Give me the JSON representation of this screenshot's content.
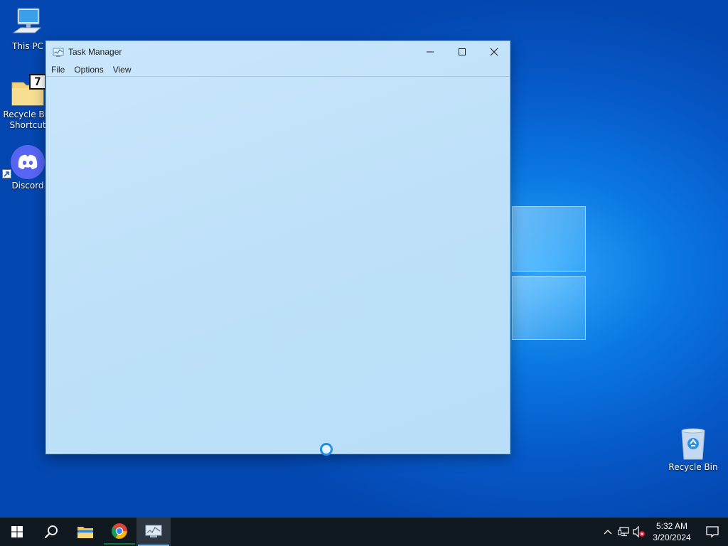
{
  "desktop": {
    "icons": [
      {
        "label_line1": "This PC",
        "label_line2": "",
        "icon": "computer-icon"
      },
      {
        "label_line1": "Recycle Bin",
        "label_line2": "Shortcut",
        "icon": "seven-zip-folder-icon"
      },
      {
        "label_line1": "Discord",
        "label_line2": "",
        "icon": "discord-icon"
      },
      {
        "label_line1": "Recycle Bin",
        "label_line2": "",
        "icon": "recycle-bin-icon"
      }
    ],
    "seven_zip_badge": "7"
  },
  "task_manager": {
    "title": "Task Manager",
    "menu": [
      "File",
      "Options",
      "View"
    ],
    "controls": {
      "minimize": "—",
      "maximize": "☐",
      "close": "✕"
    },
    "status": "loading"
  },
  "taskbar": {
    "items": [
      "start-icon",
      "search-icon",
      "file-explorer-icon",
      "chrome-icon",
      "task-manager-icon"
    ],
    "active_item": "task-manager-icon",
    "clock": {
      "time": "5:32 AM",
      "date": "3/20/2024"
    },
    "tray": [
      "chevron-up-icon",
      "network-icon",
      "volume-muted-icon",
      "notification-icon"
    ]
  },
  "colors": {
    "accent": "#0a78e0",
    "taskbar": "#101820",
    "window_bg": "#c9e6fb"
  }
}
